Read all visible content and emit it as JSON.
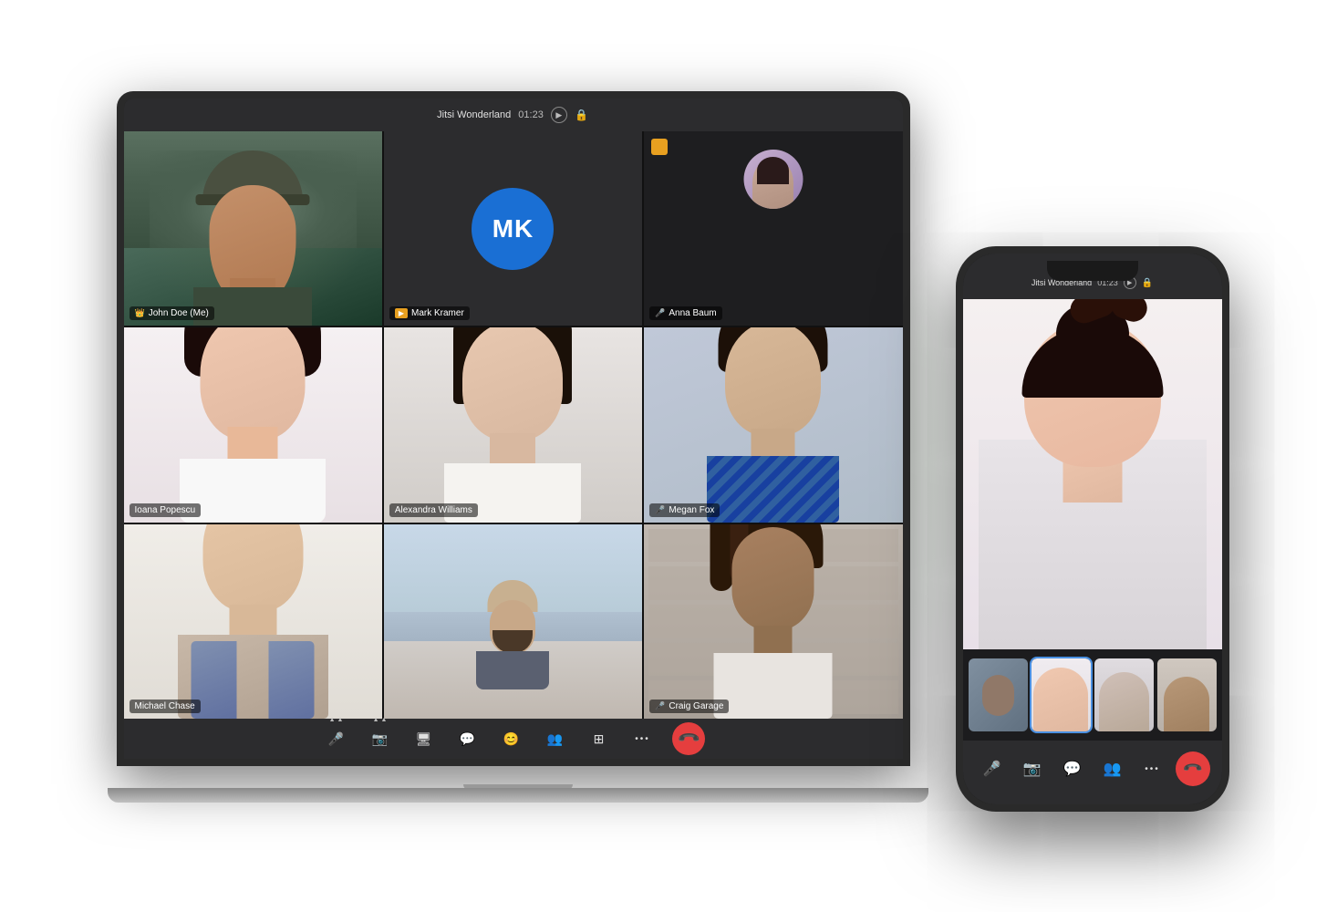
{
  "app": {
    "title": "Jitsi Wonderland",
    "call_time": "01:23"
  },
  "laptop": {
    "participants": [
      {
        "id": "john-doe",
        "name": "John Doe (Me)",
        "has_crown": true,
        "cell_class": "cell-john",
        "highlighted": false
      },
      {
        "id": "mark-kramer",
        "name": "Mark Kramer",
        "initials": "MK",
        "cell_class": "cell-mark",
        "highlighted": false
      },
      {
        "id": "anna-baum",
        "name": "Anna Baum",
        "cell_class": "cell-anna",
        "mic_off": true,
        "highlighted": false
      },
      {
        "id": "ioana-popescu",
        "name": "Ioana Popescu",
        "cell_class": "cell-ioana",
        "highlighted": true
      },
      {
        "id": "alexandra-williams",
        "name": "Alexandra Williams",
        "cell_class": "cell-alexandra",
        "highlighted": false
      },
      {
        "id": "megan-fox",
        "name": "Megan Fox",
        "cell_class": "cell-megan",
        "mic_off": true,
        "highlighted": false
      },
      {
        "id": "michael-chase",
        "name": "Michael Chase",
        "cell_class": "cell-chase",
        "highlighted": false
      },
      {
        "id": "lake-person",
        "name": "",
        "cell_class": "cell-lake",
        "highlighted": false
      },
      {
        "id": "craig-garage",
        "name": "Craig Garage",
        "cell_class": "cell-craig",
        "mic_off": true,
        "highlighted": false
      }
    ],
    "toolbar": {
      "mic_label": "🎤",
      "camera_label": "📷",
      "screen_label": "🖥",
      "chat_label": "💬",
      "emoji_label": "😊",
      "participants_label": "👥",
      "grid_label": "⊞",
      "more_label": "•••",
      "end_call_label": "📞"
    }
  },
  "phone": {
    "title": "Jitsi Wonderland",
    "call_time": "01:23",
    "thumbnails": [
      {
        "id": "thumb-1",
        "bg": "thumb-bg-1"
      },
      {
        "id": "thumb-2",
        "bg": "thumb-bg-2",
        "active": true
      },
      {
        "id": "thumb-3",
        "bg": "thumb-bg-3"
      },
      {
        "id": "thumb-4",
        "bg": "thumb-bg-4"
      }
    ],
    "toolbar": {
      "mic_label": "🎤",
      "camera_label": "📷",
      "chat_label": "💬",
      "participants_label": "👥",
      "more_label": "•••",
      "end_call_label": "📞"
    }
  }
}
